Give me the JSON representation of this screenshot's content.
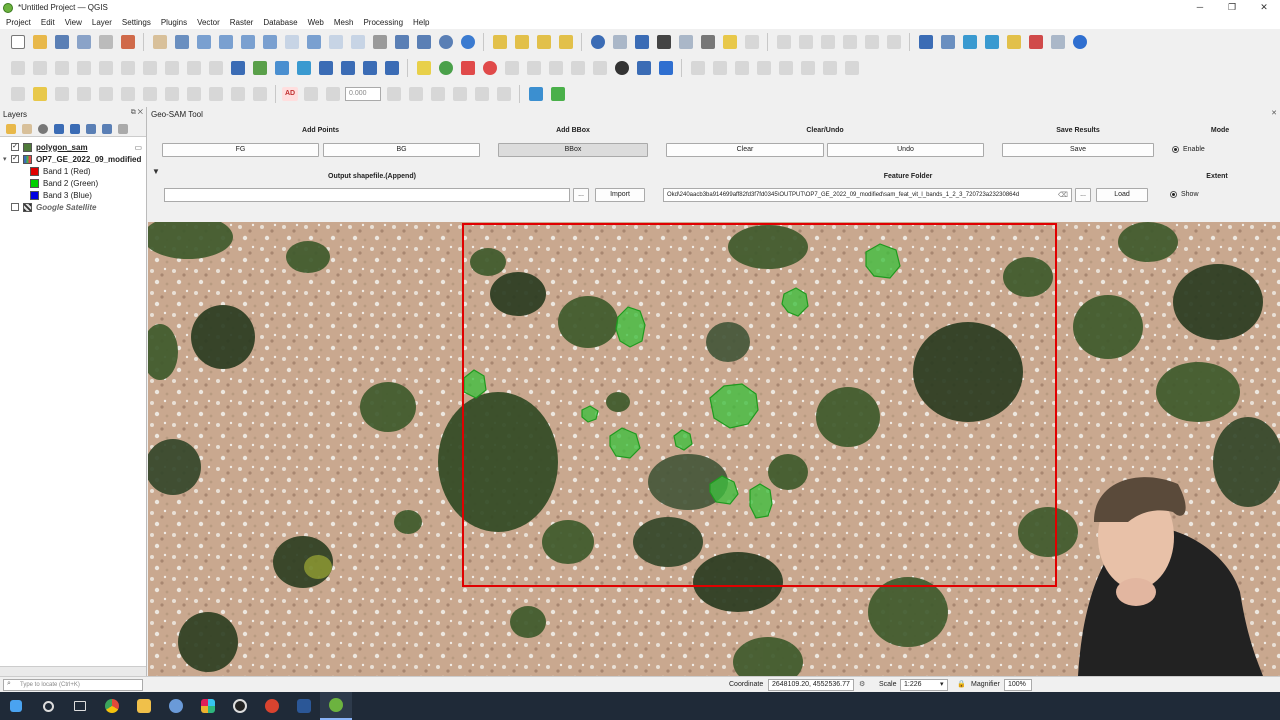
{
  "window": {
    "title": "*Untitled Project — QGIS"
  },
  "menu": [
    "Project",
    "Edit",
    "View",
    "Layer",
    "Settings",
    "Plugins",
    "Vector",
    "Raster",
    "Database",
    "Web",
    "Mesh",
    "Processing",
    "Help"
  ],
  "toolbar": {
    "rotation_value": "0.000",
    "label_tool": "AD"
  },
  "layers_panel": {
    "title": "Layers",
    "items": [
      {
        "label": "polygon_sam",
        "checked": true,
        "bold": true,
        "underline": true,
        "swatch": "#4f7a3a"
      },
      {
        "label": "OP7_GE_2022_09_modified",
        "checked": true,
        "bold": true,
        "swatch": "raster"
      },
      {
        "label": "Band 1 (Red)",
        "swatch": "#e00000"
      },
      {
        "label": "Band 2 (Green)",
        "swatch": "#00d000"
      },
      {
        "label": "Band 3 (Blue)",
        "swatch": "#0000e0"
      },
      {
        "label": "Google Satellite",
        "checked": false,
        "italic": true,
        "swatch": "xyz"
      }
    ]
  },
  "geosam": {
    "title": "Geo-SAM Tool",
    "sections": {
      "add_points": "Add Points",
      "add_bbox": "Add BBox",
      "clear_undo": "Clear/Undo",
      "save_results": "Save Results",
      "mode": "Mode",
      "output_shapefile": "Output shapefile.(Append)",
      "feature_folder": "Feature Folder",
      "extent": "Extent"
    },
    "buttons": {
      "fg": "FG",
      "bg": "BG",
      "bbox": "BBox",
      "clear": "Clear",
      "undo": "Undo",
      "save": "Save",
      "browse": "...",
      "import": "Import",
      "load": "Load"
    },
    "mode_option": "Enable",
    "extent_option": "Show",
    "output_path": "",
    "feature_folder_path": "Okd\\240aacb3ba914699aff82fd3f7fd0345\\OUTPUT\\OP7_GE_2022_09_modified\\sam_feat_vit_l_bands_1_2_3_720723a23230864d"
  },
  "statusbar": {
    "locate_placeholder": "Type to locate (Ctrl+K)",
    "coordinate_label": "Coordinate",
    "coordinate_value": "2648109.20, 4552536.77",
    "scale_label": "Scale",
    "scale_value": "1:226",
    "magnifier_label": "Magnifier",
    "magnifier_value": "100%"
  },
  "colors": {
    "bbox_outline": "#e00000",
    "polygon_fill": "#3fbf3f",
    "polygon_outline": "#1f9a1f"
  }
}
